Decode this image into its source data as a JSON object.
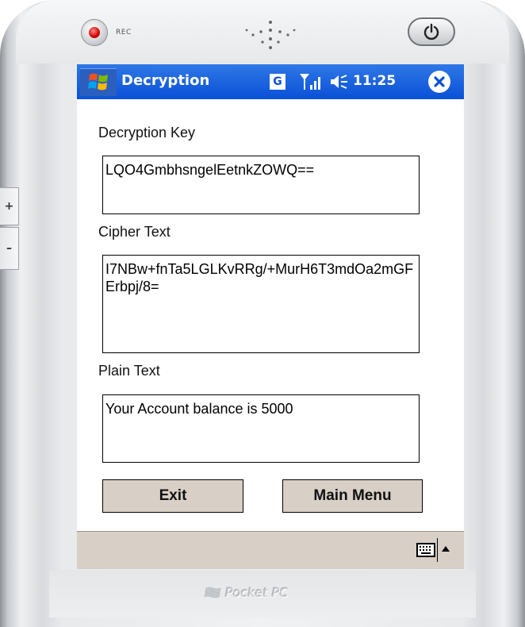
{
  "device": {
    "rec_label": "REC",
    "brand": "Pocket PC",
    "side_plus": "+",
    "side_minus": "–"
  },
  "titlebar": {
    "title": "Decryption",
    "status_badge": "G",
    "time": "11:25"
  },
  "form": {
    "key_label": "Decryption Key",
    "key_value": "LQO4GmbhsngelEetnkZOWQ==",
    "cipher_label": "Cipher Text",
    "cipher_value": "I7NBw+fnTa5LGLKvRRg/+MurH6T3mdOa2mGFErbpj/8=",
    "plain_label": "Plain Text",
    "plain_value": "Your Account balance is 5000"
  },
  "buttons": {
    "exit": "Exit",
    "main_menu": "Main Menu"
  },
  "colors": {
    "titlebar": "#0a50d8",
    "button_face": "#d8cfc6",
    "menubar": "#d8cfc6"
  },
  "icons": {
    "start": "windows-flag-icon",
    "signal": "signal-icon",
    "volume": "volume-icon",
    "close": "close-icon",
    "keyboard": "keyboard-icon"
  }
}
